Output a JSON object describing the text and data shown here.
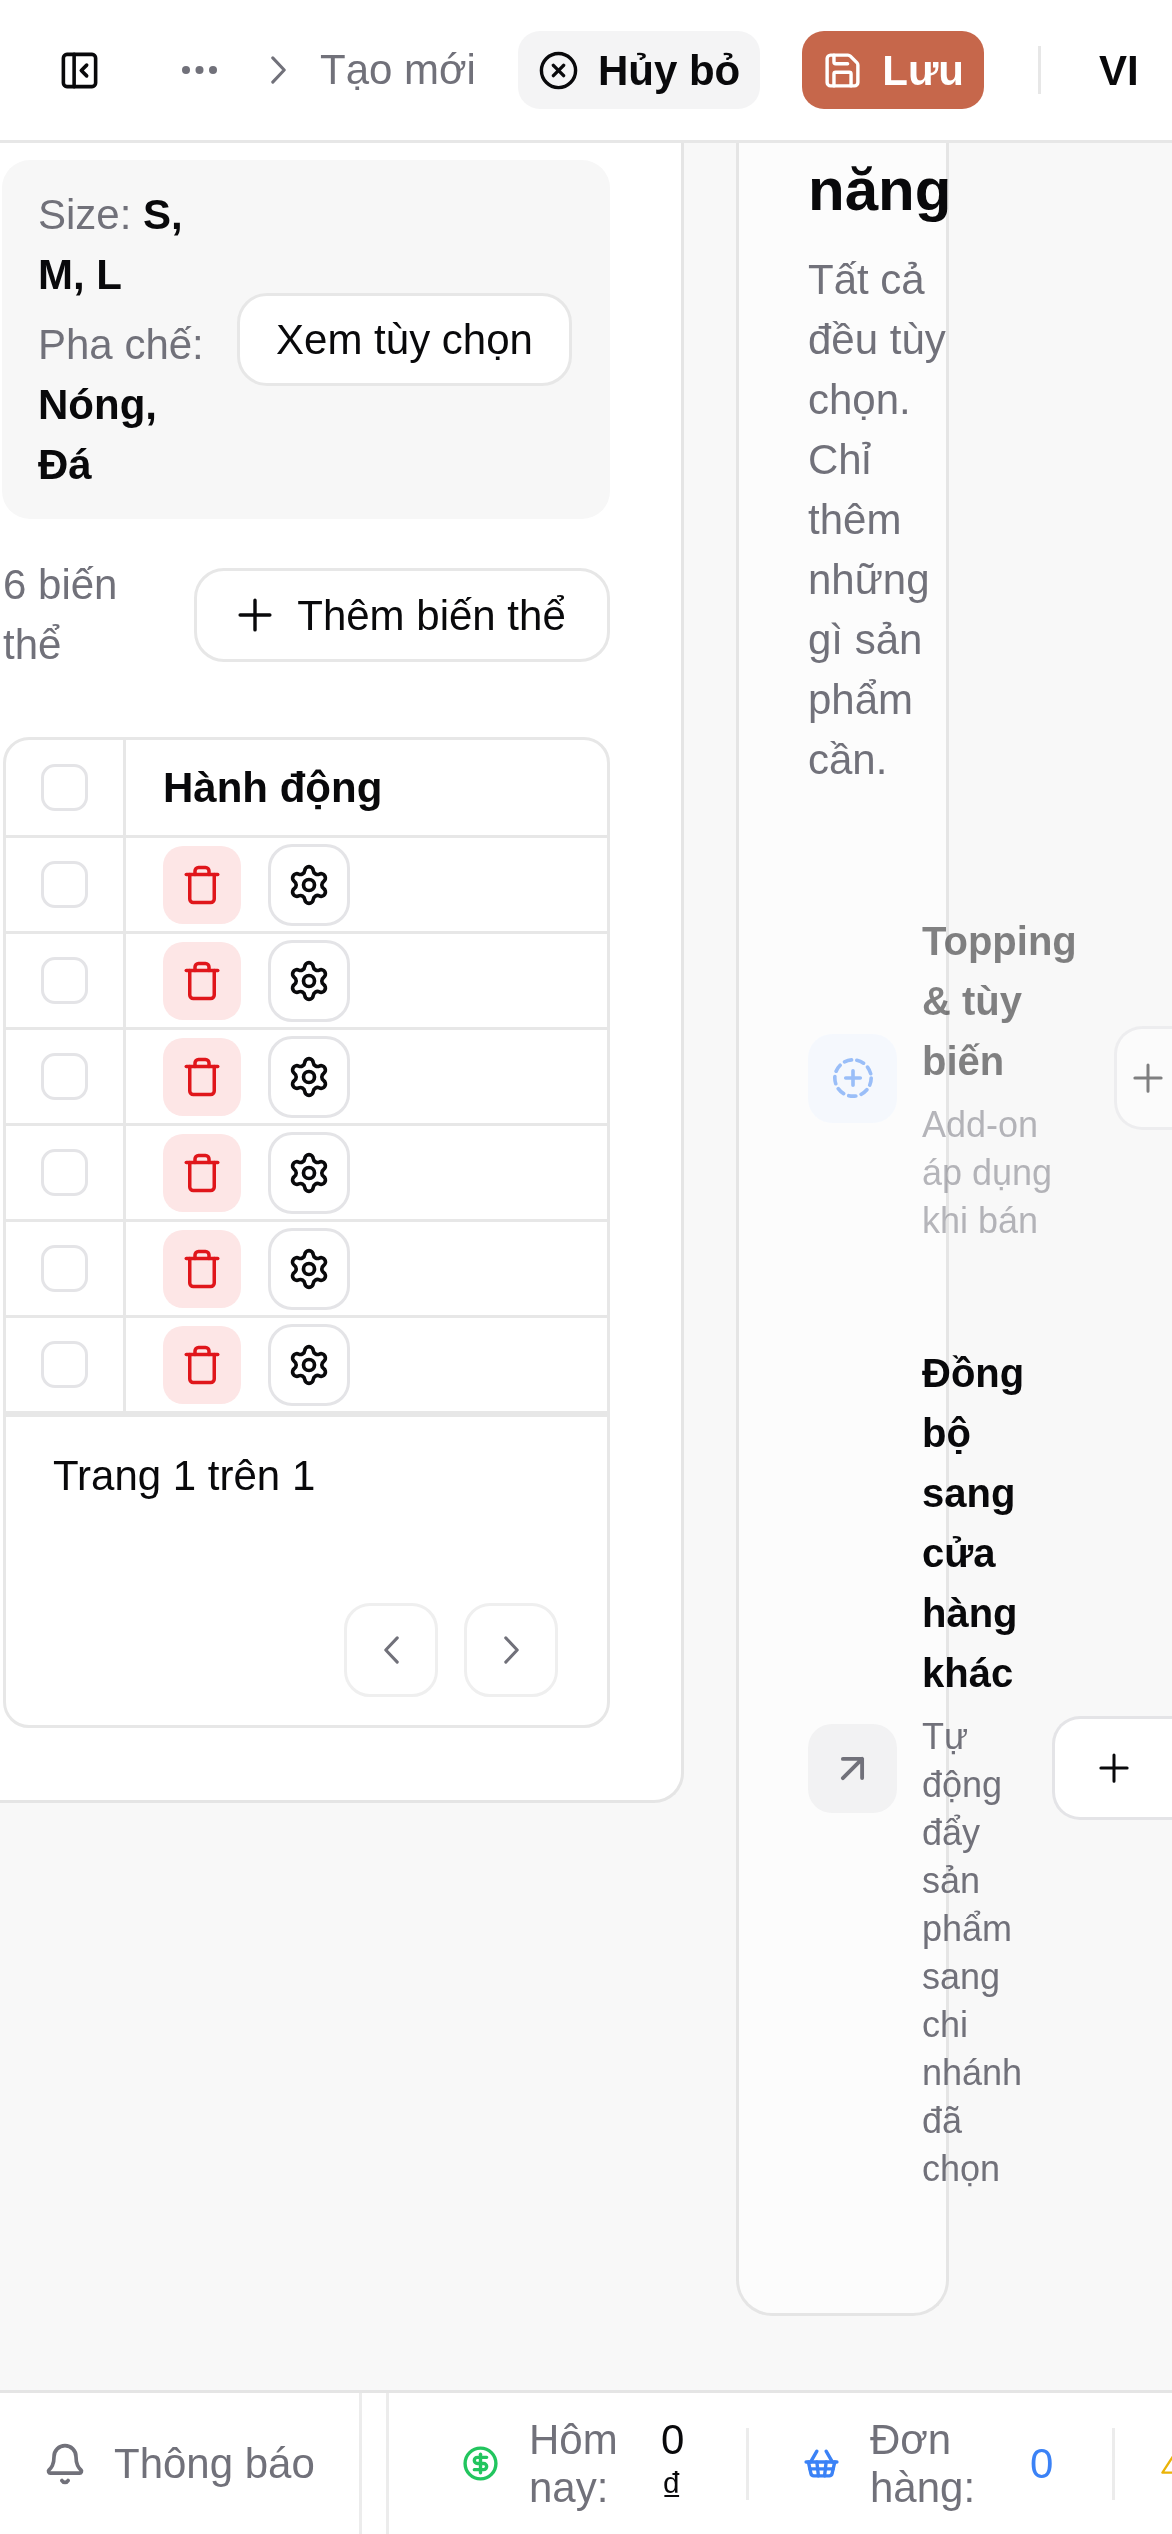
{
  "header": {
    "breadcrumb_current": "Tạo mới",
    "buttons": [
      {
        "kind": "cancel",
        "label": "Hủy bỏ"
      },
      {
        "kind": "save",
        "label": "Lưu"
      }
    ],
    "language": "VI"
  },
  "variants_panel": {
    "options": [
      {
        "label": "Size:",
        "value": "S, M, L"
      },
      {
        "label": "Pha chế:",
        "value": "Nóng, Đá"
      }
    ],
    "view_options_button": "Xem tùy chọn",
    "variant_count": "6 biến thể",
    "add_variant_button": "Thêm biến thể",
    "table": {
      "select_all": {
        "checked": false
      },
      "columns": [
        "Hành động"
      ],
      "rows": [
        {
          "checked": false
        },
        {
          "checked": false
        },
        {
          "checked": false
        },
        {
          "checked": false
        },
        {
          "checked": false
        },
        {
          "checked": false
        }
      ]
    },
    "pagination": {
      "label": "Trang 1 trên 1",
      "prev": {
        "disabled": true
      },
      "next": {
        "disabled": true
      }
    }
  },
  "features_panel": {
    "heading": "năng",
    "description": "Tất cả đều tùy chọn. Chỉ thêm những gì sản phẩm cần.",
    "items": [
      {
        "kind": "addon",
        "title": "Topping & tùy biến",
        "description": "Add-on áp dụng khi bán",
        "disabled": true
      },
      {
        "kind": "sync",
        "title": "Đồng bộ sang cửa hàng khác",
        "description": "Tự động đẩy sản phẩm sang chi nhánh đã chọn",
        "disabled": false
      }
    ]
  },
  "status_bar": {
    "notifications": "Thông báo",
    "stats": [
      {
        "kind": "revenue",
        "label": "Hôm nay:",
        "value": "0 ₫"
      },
      {
        "kind": "orders",
        "label": "Đơn hàng:",
        "value": "0"
      }
    ]
  }
}
